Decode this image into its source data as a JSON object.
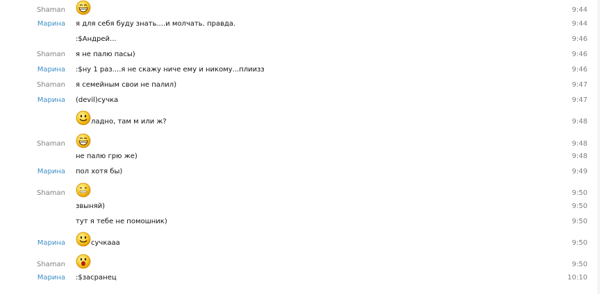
{
  "messages": [
    {
      "sender": "Shaman",
      "role": "other",
      "text": "",
      "emoticon": "grin-face",
      "time": "9:44"
    },
    {
      "sender": "Марина",
      "role": "self",
      "text": "я для себя буду знать....и молчать. правда.",
      "time": "9:44"
    },
    {
      "sender": "",
      "role": "self",
      "text": ":$Андрей...",
      "time": "9:46"
    },
    {
      "sender": "Shaman",
      "role": "other",
      "text": "я не палю пасы)",
      "time": "9:46"
    },
    {
      "sender": "Марина",
      "role": "self",
      "text": ":$ну 1 раз....я не скажу ниче ему и никому...плиизз",
      "time": "9:46"
    },
    {
      "sender": "Shaman",
      "role": "other",
      "text": "я семейным свои не палил)",
      "time": "9:47"
    },
    {
      "sender": "Марина",
      "role": "self",
      "text": "(devil)сучка",
      "time": "9:47"
    },
    {
      "sender": "",
      "role": "self",
      "text": "ладно, там м или ж?",
      "emoticon": "smile-face",
      "time": "9:48"
    },
    {
      "sender": "Shaman",
      "role": "other",
      "text": "",
      "emoticon": "grin-face",
      "time": "9:48"
    },
    {
      "sender": "",
      "role": "other",
      "text": "не палю грю же)",
      "time": "9:48"
    },
    {
      "sender": "Марина",
      "role": "self",
      "text": "пол хотя бы)",
      "time": "9:49"
    },
    {
      "sender": "Shaman",
      "role": "other",
      "text": "",
      "emoticon": "zipped-face",
      "time": "9:50"
    },
    {
      "sender": "",
      "role": "other",
      "text": "звыняй)",
      "time": "9:50"
    },
    {
      "sender": "",
      "role": "other",
      "text": "тут я тебе не помошник)",
      "time": "9:50"
    },
    {
      "sender": "Марина",
      "role": "self",
      "text": "сучкааа",
      "emoticon": "smile-face",
      "time": "9:50"
    },
    {
      "sender": "Shaman",
      "role": "other",
      "text": "",
      "emoticon": "surprised-face",
      "time": "9:50"
    },
    {
      "sender": "Марина",
      "role": "self",
      "text": ":$засранец",
      "time": "10:10"
    }
  ],
  "colors": {
    "self_sender": "#3d8fc4",
    "other_sender": "#808080",
    "time": "#808080",
    "text": "#111111",
    "emoticon_fill": "#f7c21f",
    "emoticon_outline": "#c98a05"
  }
}
